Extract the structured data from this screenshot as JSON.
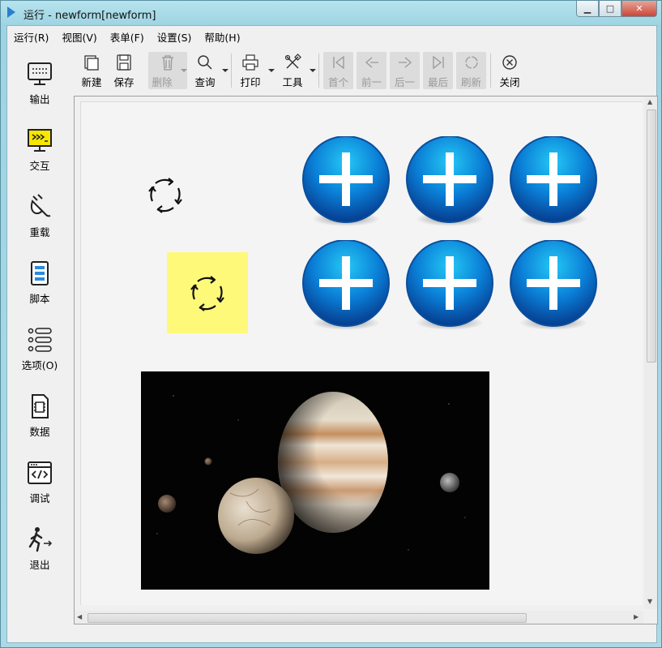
{
  "window": {
    "title": "运行 - newform[newform]",
    "min_label": "▁",
    "max_label": "□",
    "close_label": "✕"
  },
  "menu": [
    "运行(R)",
    "视图(V)",
    "表单(F)",
    "设置(S)",
    "帮助(H)"
  ],
  "sidebar": [
    {
      "label": "输出",
      "icon": "monitor-icon"
    },
    {
      "label": "交互",
      "icon": "terminal-icon"
    },
    {
      "label": "重载",
      "icon": "plug-icon"
    },
    {
      "label": "脚本",
      "icon": "script-icon"
    },
    {
      "label": "选项(O)",
      "icon": "options-list-icon"
    },
    {
      "label": "数据",
      "icon": "data-chip-icon"
    },
    {
      "label": "调试",
      "icon": "code-window-icon"
    },
    {
      "label": "退出",
      "icon": "exit-run-icon"
    }
  ],
  "toolbar": {
    "new": "新建",
    "save": "保存",
    "delete": "删除",
    "query": "查询",
    "print": "打印",
    "tools": "工具",
    "first": "首个",
    "prev": "前一",
    "next": "后一",
    "last": "最后",
    "refresh": "刷新",
    "close": "关闭"
  },
  "colors": {
    "plus_button": "#0e6fcf",
    "highlight_box": "#fff97a",
    "titlebar": "#a9dbe7"
  }
}
